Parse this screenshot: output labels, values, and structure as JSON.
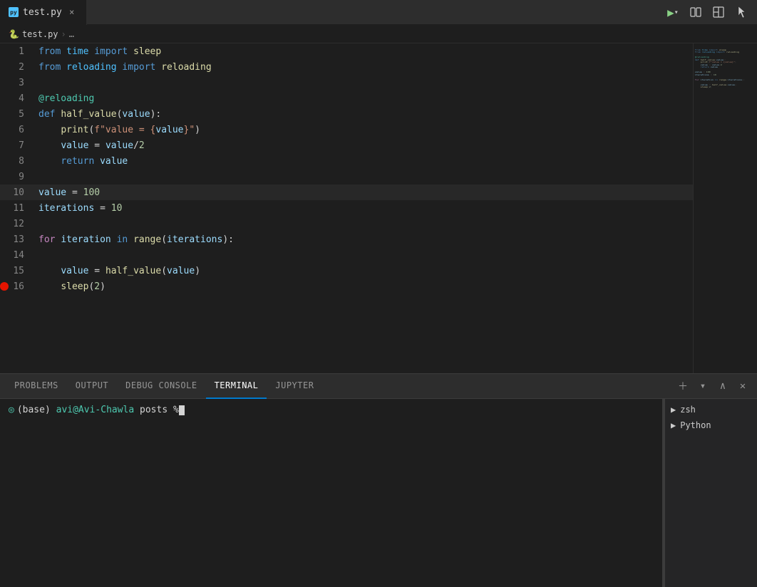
{
  "tab": {
    "filename": "test.py",
    "close_label": "×"
  },
  "breadcrumb": {
    "file": "test.py",
    "separator": "›",
    "ellipsis": "…"
  },
  "toolbar": {
    "run_btn_title": "Run Python File",
    "dropdown_title": "Select Debug Configuration",
    "split_title": "Split Editor",
    "layout_title": "Editor Layout"
  },
  "code": {
    "lines": [
      {
        "num": 1,
        "content": "from time import sleep"
      },
      {
        "num": 2,
        "content": "from reloading import reloading"
      },
      {
        "num": 3,
        "content": ""
      },
      {
        "num": 4,
        "content": "@reloading"
      },
      {
        "num": 5,
        "content": "def half_value(value):"
      },
      {
        "num": 6,
        "content": "    print(f\"value = {value}\")"
      },
      {
        "num": 7,
        "content": "    value = value/2"
      },
      {
        "num": 8,
        "content": "    return value"
      },
      {
        "num": 9,
        "content": ""
      },
      {
        "num": 10,
        "content": "value = 100",
        "active": true
      },
      {
        "num": 11,
        "content": "iterations = 10"
      },
      {
        "num": 12,
        "content": ""
      },
      {
        "num": 13,
        "content": "for iteration in range(iterations):"
      },
      {
        "num": 14,
        "content": ""
      },
      {
        "num": 15,
        "content": "    value = half_value(value)"
      },
      {
        "num": 16,
        "content": "    sleep(2)",
        "breakpoint": true
      }
    ]
  },
  "panel": {
    "tabs": [
      "PROBLEMS",
      "OUTPUT",
      "DEBUG CONSOLE",
      "TERMINAL",
      "JUPYTER"
    ],
    "active_tab": "TERMINAL",
    "terminal_prompt": "(base) avi@Avi-Chawla posts %",
    "terminals": [
      {
        "name": "zsh",
        "icon": "terminal"
      },
      {
        "name": "Python",
        "icon": "terminal"
      }
    ]
  }
}
